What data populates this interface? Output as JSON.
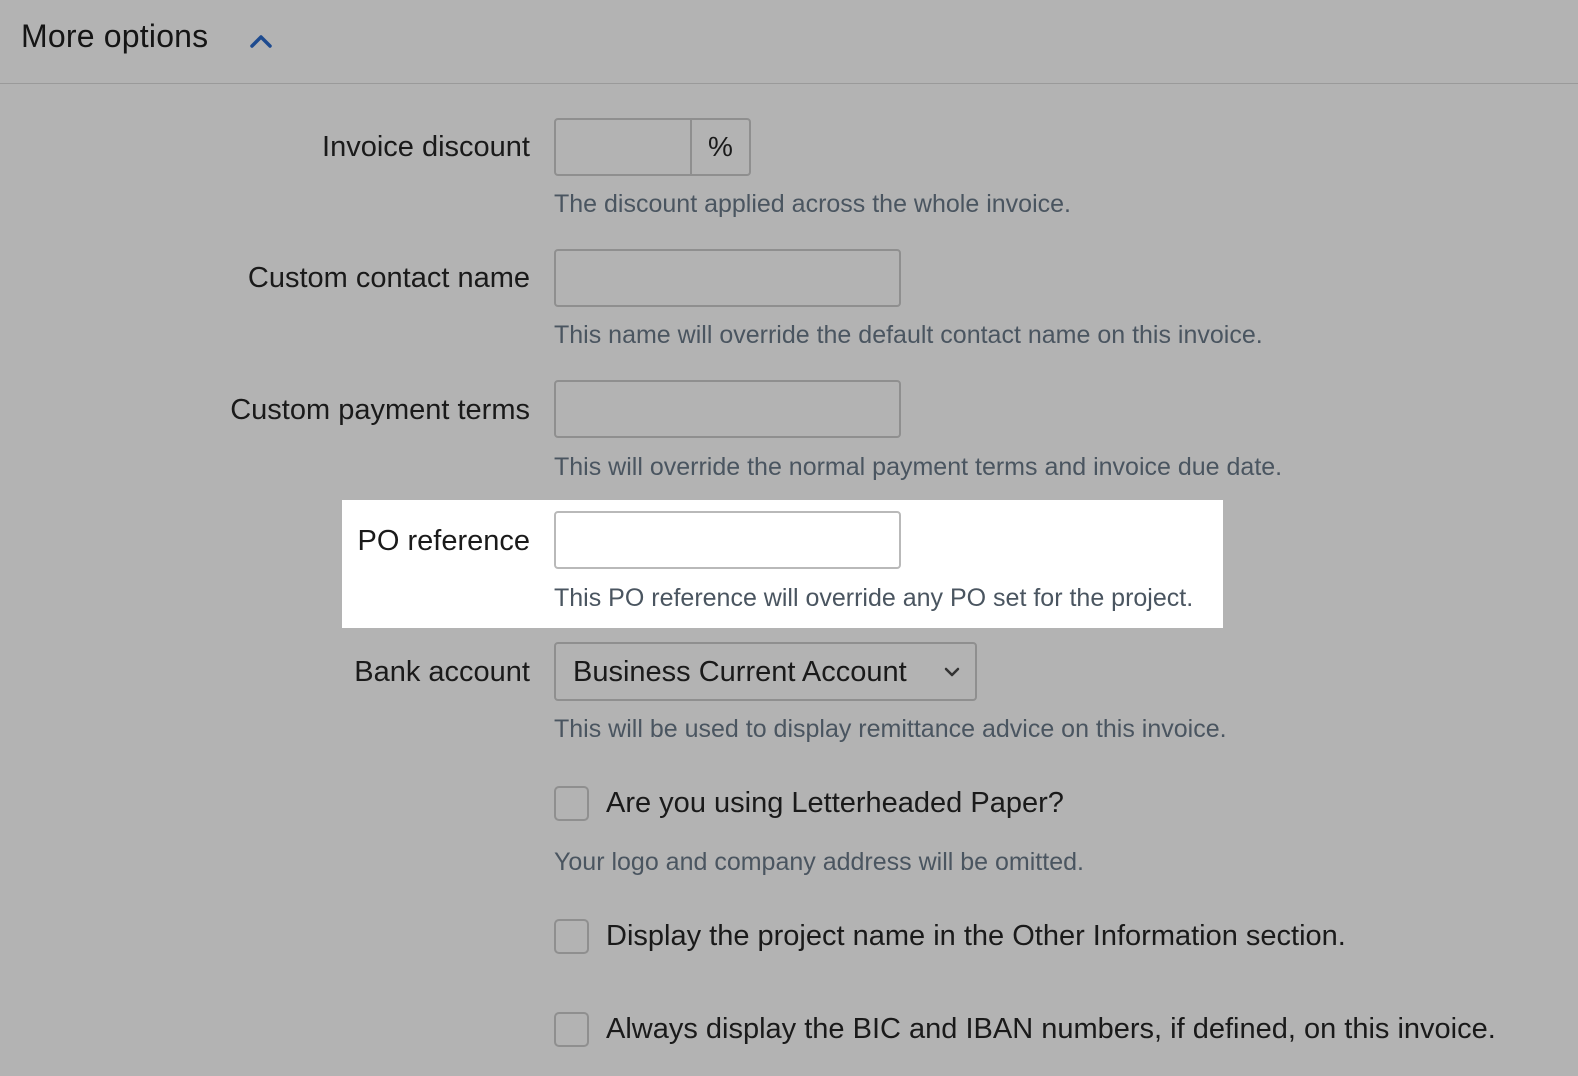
{
  "header": {
    "title": "More options",
    "toggle_icon": "chevron-up-icon",
    "accent_color": "#1e4b8f"
  },
  "form": {
    "invoice_discount": {
      "label": "Invoice discount",
      "value": "",
      "addon": "%",
      "help": "The discount applied across the whole invoice."
    },
    "custom_contact_name": {
      "label": "Custom contact name",
      "value": "",
      "help": "This name will override the default contact name on this invoice."
    },
    "custom_payment_terms": {
      "label": "Custom payment terms",
      "value": "",
      "help": "This will override the normal payment terms and invoice due date."
    },
    "po_reference": {
      "label": "PO reference",
      "value": "",
      "help": "This PO reference will override any PO set for the project."
    },
    "bank_account": {
      "label": "Bank account",
      "selected": "Business Current Account",
      "chevron_icon": "chevron-down-icon",
      "help": "This will be used to display remittance advice on this invoice."
    },
    "letterheaded_paper": {
      "label": "Are you using Letterheaded Paper?",
      "checked": false,
      "help": "Your logo and company address will be omitted."
    },
    "display_project_name": {
      "label": "Display the project name in the Other Information section.",
      "checked": false
    },
    "display_bic_iban": {
      "label": "Always display the BIC and IBAN numbers, if defined, on this invoice.",
      "checked": false
    }
  }
}
